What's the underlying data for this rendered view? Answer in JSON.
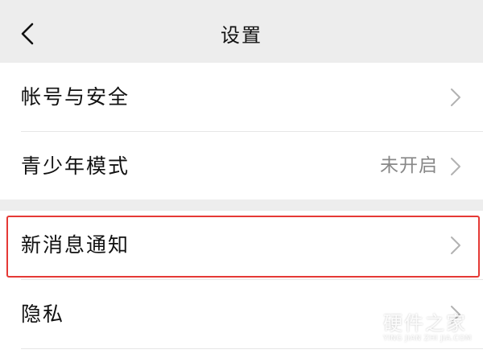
{
  "header": {
    "title": "设置",
    "back_icon": "chevron-left-icon"
  },
  "settings": {
    "group1": [
      {
        "label": "帐号与安全",
        "value": "",
        "icon": "chevron-right-icon"
      },
      {
        "label": "青少年模式",
        "value": "未开启",
        "icon": "chevron-right-icon"
      }
    ],
    "group2": [
      {
        "label": "新消息通知",
        "value": "",
        "icon": "chevron-right-icon",
        "highlighted": true
      },
      {
        "label": "隐私",
        "value": "",
        "icon": "chevron-right-icon"
      }
    ]
  },
  "watermark": {
    "title": "硬件之家",
    "subtitle": "YING JIAN ZHI JIA.COM"
  },
  "colors": {
    "background": "#ededed",
    "card": "#ffffff",
    "highlight_border": "#e53935",
    "secondary_text": "#888888"
  }
}
